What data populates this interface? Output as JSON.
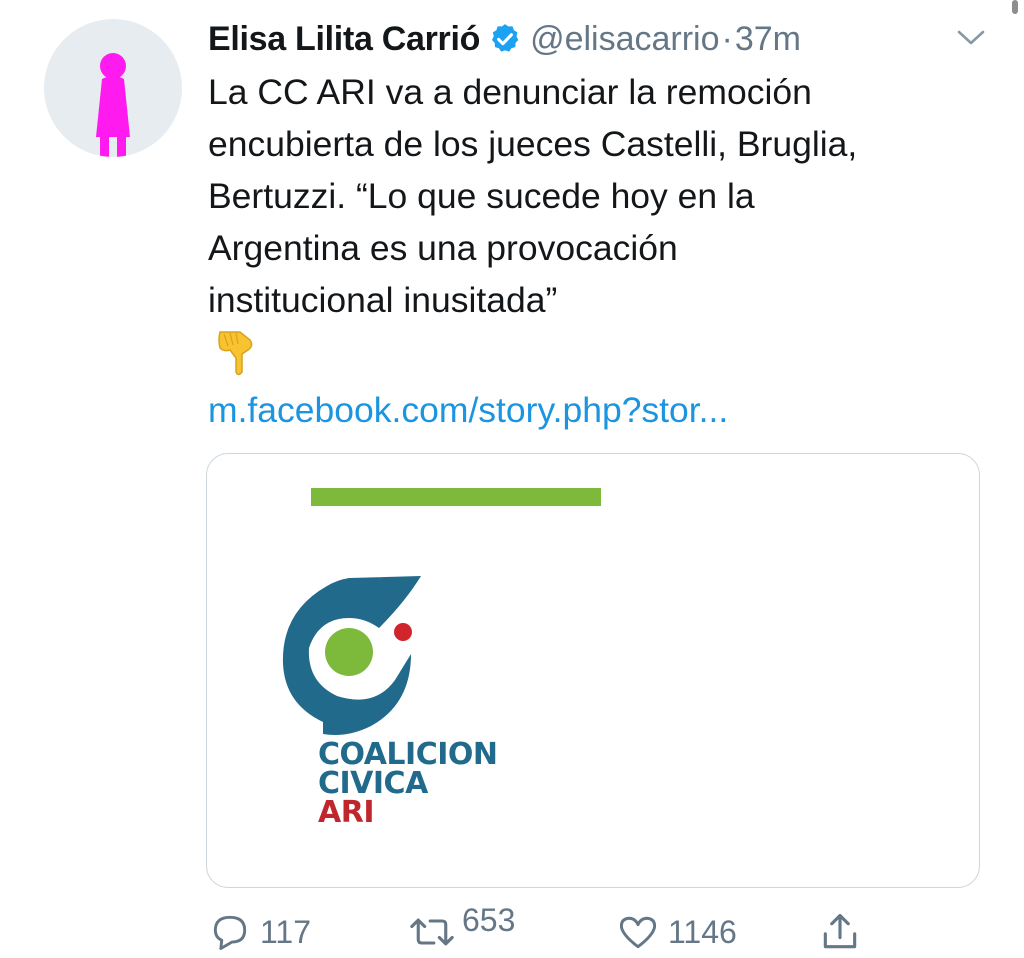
{
  "tweet": {
    "author": {
      "display_name": "Elisa Lilita Carrió",
      "handle": "@elisacarrio",
      "verified": true,
      "avatar_color": "#ff1bf0"
    },
    "separator": "·",
    "time": "37m",
    "text_lines": [
      "La CC ARI va a denunciar la remoción",
      "encubierta de los jueces Castelli, Bruglia,",
      "Bertuzzi. “Lo que sucede hoy en la",
      "Argentina es una provocación",
      "institucional inusitada”"
    ],
    "emoji": "backhand-index-pointing-down",
    "link": "m.facebook.com/story.php?stor...",
    "card": {
      "logo_lines": [
        "COALICION",
        "CIVICA",
        "ARI"
      ],
      "bar_color": "#7dba3c",
      "logo_blue": "#226a8c",
      "logo_green": "#7dba3c",
      "logo_red": "#c0272d"
    },
    "actions": {
      "reply_count": "117",
      "retweet_count": "653",
      "like_count": "1146"
    }
  },
  "icons": {
    "verified": "verified-badge-icon",
    "caret": "chevron-down-icon",
    "reply": "reply-bubble-icon",
    "retweet": "retweet-arrows-icon",
    "like": "heart-icon",
    "share": "share-upload-icon"
  },
  "colors": {
    "link": "#1b95e0",
    "muted": "#657786",
    "text": "#14171a",
    "verified": "#1da1f2"
  }
}
